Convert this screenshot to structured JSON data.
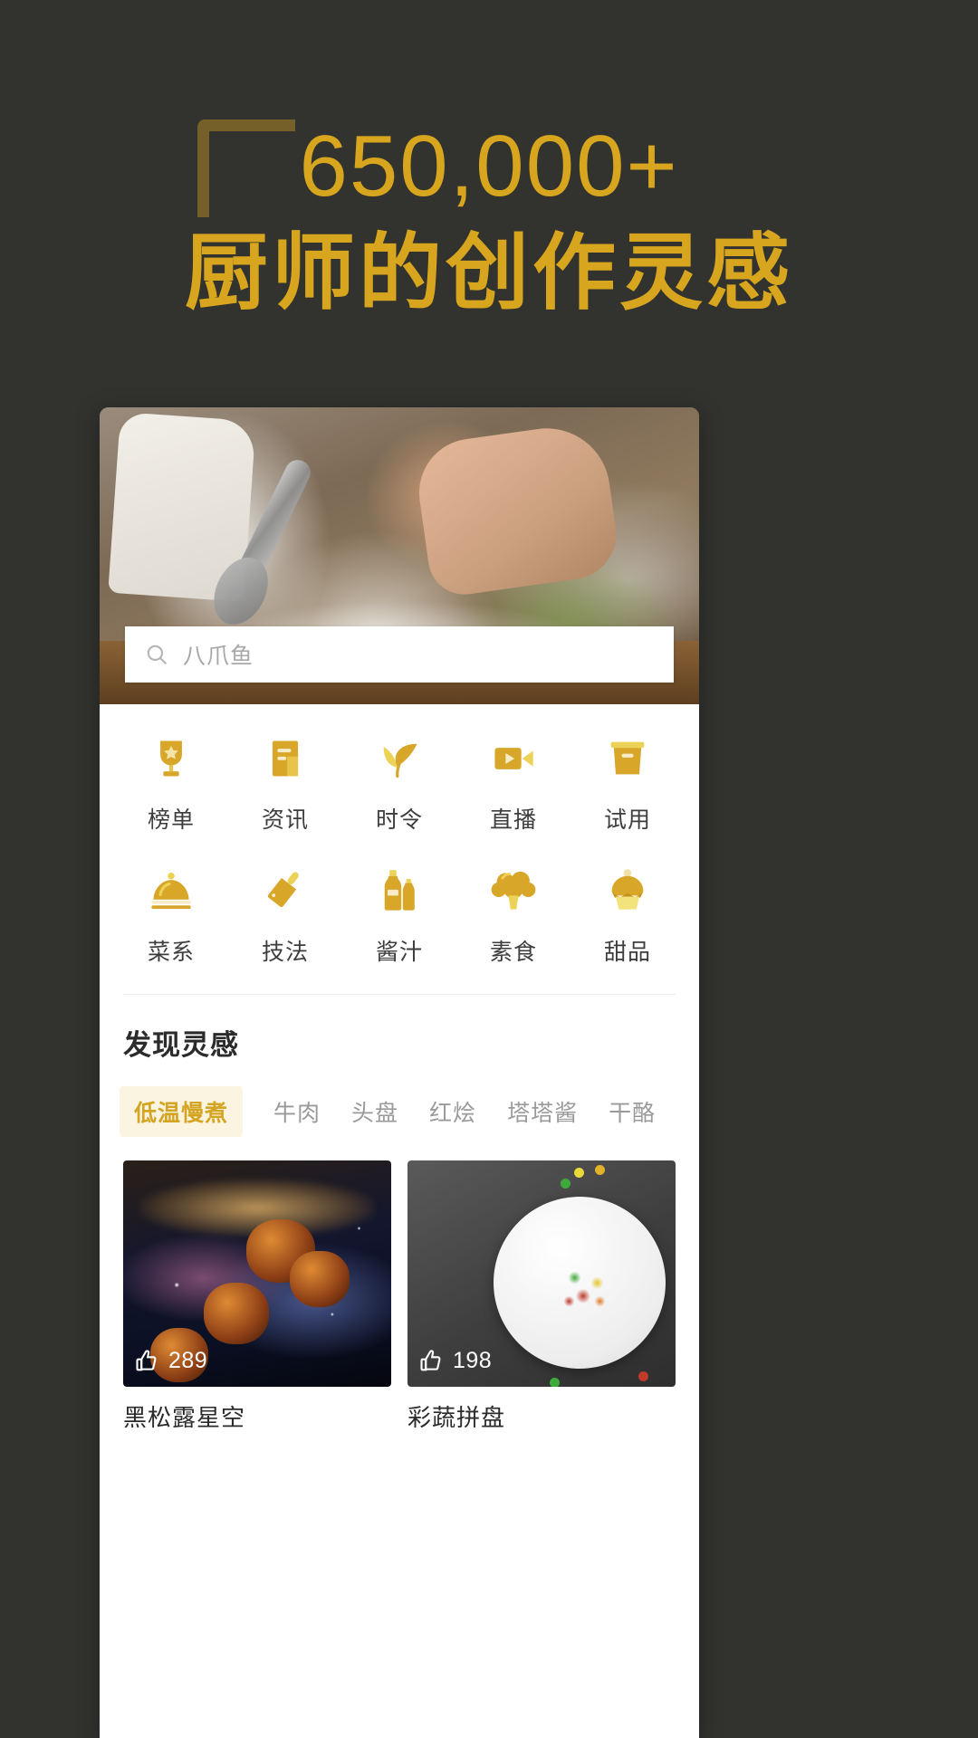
{
  "hero": {
    "headline_number": "650,000+",
    "headline_text": "厨师的创作灵感",
    "accent_color": "#d8a61e",
    "background_color": "#32332f"
  },
  "app": {
    "search": {
      "placeholder": "八爪鱼",
      "icon": "search-icon"
    },
    "quick_links": [
      {
        "label": "榜单",
        "icon": "trophy-icon"
      },
      {
        "label": "资讯",
        "icon": "document-icon"
      },
      {
        "label": "时令",
        "icon": "leaf-icon"
      },
      {
        "label": "直播",
        "icon": "video-camera-icon"
      },
      {
        "label": "试用",
        "icon": "box-icon"
      },
      {
        "label": "菜系",
        "icon": "cloche-icon"
      },
      {
        "label": "技法",
        "icon": "cleaver-icon"
      },
      {
        "label": "酱汁",
        "icon": "sauce-bottle-icon"
      },
      {
        "label": "素食",
        "icon": "broccoli-icon"
      },
      {
        "label": "甜品",
        "icon": "cupcake-icon"
      }
    ],
    "discover": {
      "title": "发现灵感",
      "tabs": [
        {
          "label": "低温慢煮",
          "active": true
        },
        {
          "label": "牛肉",
          "active": false
        },
        {
          "label": "头盘",
          "active": false
        },
        {
          "label": "红烩",
          "active": false
        },
        {
          "label": "塔塔酱",
          "active": false
        },
        {
          "label": "干酪",
          "active": false
        }
      ],
      "active_tab_color": "#d4a422",
      "active_tab_background": "#fbf4e0",
      "cards": [
        {
          "like_count": "289",
          "like_icon": "thumbs-up-icon",
          "title": "黑松露星空"
        },
        {
          "like_count": "198",
          "like_icon": "thumbs-up-icon",
          "title": "彩蔬拼盘"
        }
      ]
    }
  }
}
